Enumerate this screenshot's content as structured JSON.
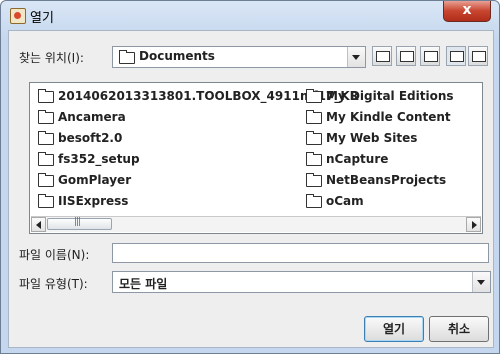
{
  "window": {
    "title": "열기",
    "close_label": "x"
  },
  "look_in": {
    "label": "찾는 위치(I):",
    "value": "Documents"
  },
  "toolbar": {
    "icons": [
      "up-folder-icon",
      "home-icon",
      "new-folder-icon",
      "list-view-icon",
      "details-view-icon"
    ]
  },
  "files": {
    "col1": [
      "2014062013313801.TOOLBOX_4911mf17_KR",
      "Ancamera",
      "besoft2.0",
      "fs352_setup",
      "GomPlayer",
      "IISExpress"
    ],
    "col2": [
      "My Digital Editions",
      "My Kindle Content",
      "My Web Sites",
      "nCapture",
      "NetBeansProjects",
      "oCam"
    ]
  },
  "filename": {
    "label": "파일 이름(N):",
    "value": ""
  },
  "filetype": {
    "label": "파일 유형(T):",
    "value": "모든 파일"
  },
  "buttons": {
    "open": "열기",
    "cancel": "취소"
  }
}
